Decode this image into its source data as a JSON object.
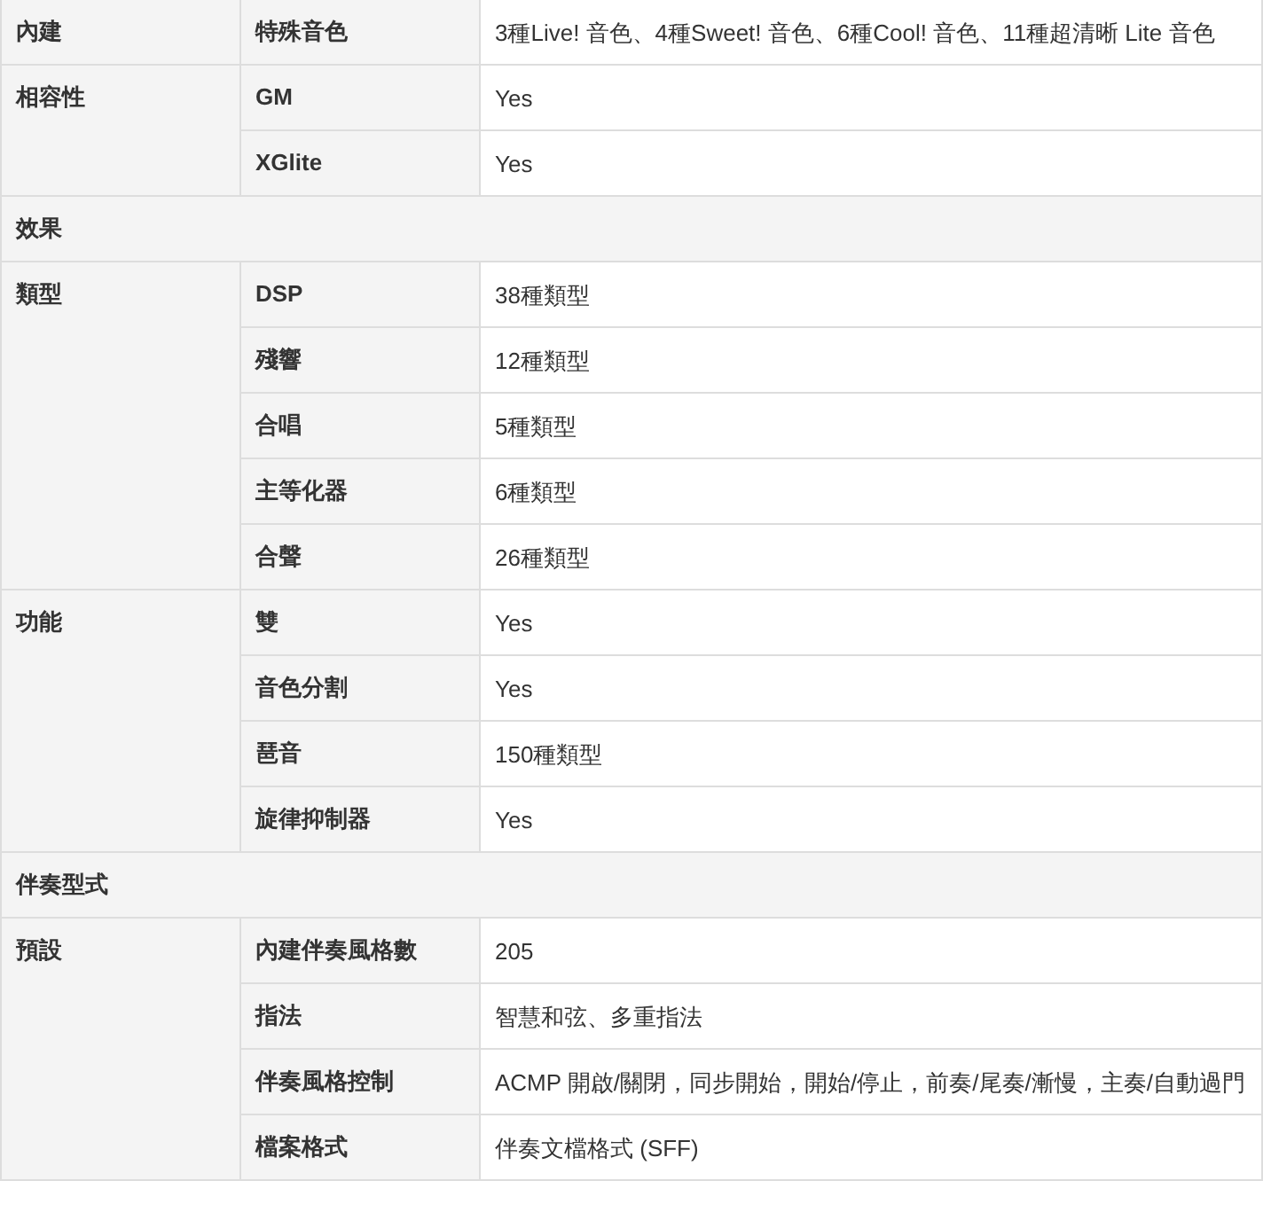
{
  "table": {
    "rows": [
      {
        "kind": "group",
        "label": "內建",
        "items": [
          {
            "label": "特殊音色",
            "value": "3種Live! 音色、4種Sweet! 音色、6種Cool! 音色、11種超清晰 Lite 音色"
          }
        ]
      },
      {
        "kind": "group",
        "label": "相容性",
        "items": [
          {
            "label": "GM",
            "value": "Yes"
          },
          {
            "label": "XGlite",
            "value": "Yes"
          }
        ]
      },
      {
        "kind": "section",
        "label": "效果"
      },
      {
        "kind": "group",
        "label": "類型",
        "items": [
          {
            "label": "DSP",
            "value": "38種類型"
          },
          {
            "label": "殘響",
            "value": "12種類型"
          },
          {
            "label": "合唱",
            "value": "5種類型"
          },
          {
            "label": "主等化器",
            "value": "6種類型"
          },
          {
            "label": "合聲",
            "value": "26種類型"
          }
        ]
      },
      {
        "kind": "group",
        "label": "功能",
        "items": [
          {
            "label": "雙",
            "value": "Yes"
          },
          {
            "label": "音色分割",
            "value": "Yes"
          },
          {
            "label": "琶音",
            "value": "150種類型"
          },
          {
            "label": "旋律抑制器",
            "value": "Yes"
          }
        ]
      },
      {
        "kind": "section",
        "label": "伴奏型式"
      },
      {
        "kind": "group",
        "label": "預設",
        "items": [
          {
            "label": "內建伴奏風格數",
            "value": "205"
          },
          {
            "label": "指法",
            "value": "智慧和弦、多重指法"
          },
          {
            "label": "伴奏風格控制",
            "value": "ACMP 開啟/關閉，同步開始，開始/停止，前奏/尾奏/漸慢，主奏/自動過門"
          },
          {
            "label": "檔案格式",
            "value": "伴奏文檔格式 (SFF)"
          }
        ]
      }
    ]
  }
}
